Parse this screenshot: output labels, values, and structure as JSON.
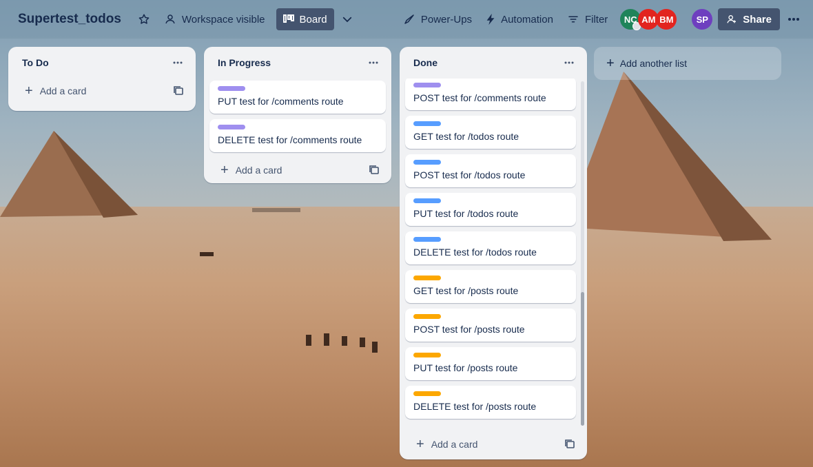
{
  "header": {
    "board_title": "Supertest_todos",
    "star_icon": "star-icon",
    "visibility_label": "Workspace visible",
    "board_view_label": "Board",
    "powerups_label": "Power-Ups",
    "automation_label": "Automation",
    "filter_label": "Filter",
    "share_label": "Share",
    "members": [
      "NC",
      "AM",
      "BM",
      "SP"
    ]
  },
  "colors": {
    "purple_label": "#9f8fef",
    "blue_label": "#579dff",
    "orange_label": "#fca700"
  },
  "lists": {
    "todo": {
      "title": "To Do",
      "add_card": "Add a card"
    },
    "progress": {
      "title": "In Progress",
      "add_card": "Add a card",
      "cards": [
        {
          "title": "PUT test for /comments route",
          "label": "purple"
        },
        {
          "title": "DELETE test for /comments route",
          "label": "purple"
        }
      ]
    },
    "done": {
      "title": "Done",
      "add_card": "Add a card",
      "cards": [
        {
          "title": "",
          "label": "purple"
        },
        {
          "title": "POST test for /comments route",
          "label": "purple"
        },
        {
          "title": "GET test for /todos route",
          "label": "blue"
        },
        {
          "title": "POST test for /todos route",
          "label": "blue"
        },
        {
          "title": "PUT test for /todos route",
          "label": "blue"
        },
        {
          "title": "DELETE test for /todos route",
          "label": "blue"
        },
        {
          "title": "GET test for /posts route",
          "label": "orange"
        },
        {
          "title": "POST test for /posts route",
          "label": "orange"
        },
        {
          "title": "PUT test for /posts route",
          "label": "orange"
        },
        {
          "title": "DELETE test for /posts route",
          "label": "orange"
        }
      ]
    }
  },
  "add_list_label": "Add another list"
}
